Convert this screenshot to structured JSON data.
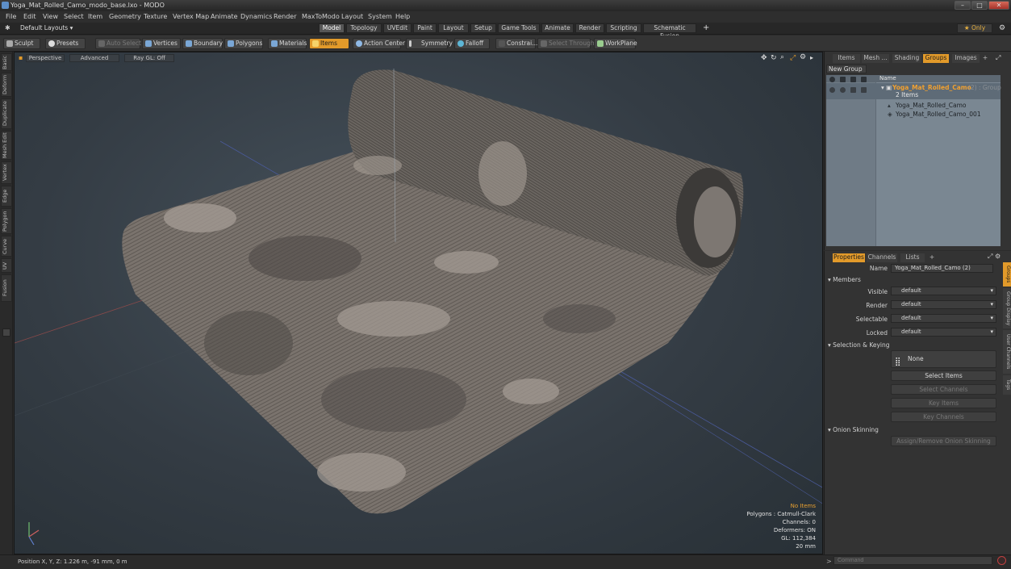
{
  "window": {
    "title": "Yoga_Mat_Rolled_Camo_modo_base.lxo - MODO",
    "buttons": [
      "–",
      "□",
      "✕"
    ]
  },
  "menu": [
    "File",
    "Edit",
    "View",
    "Select",
    "Item",
    "Geometry",
    "Texture",
    "Vertex Map",
    "Animate",
    "Dynamics",
    "Render",
    "MaxToModo",
    "Layout",
    "System",
    "Help"
  ],
  "layout_bar": {
    "layouts_label": "Default Layouts ▾",
    "tabs": [
      "Model",
      "Topology",
      "UVEdit",
      "Paint",
      "Layout",
      "Setup",
      "Game Tools",
      "Animate",
      "Render",
      "Scripting",
      "Schematic Fusion"
    ],
    "active_tab": "Model",
    "add": "+",
    "only_label": "★  Only",
    "gear": "⚙"
  },
  "toolbar": {
    "sculpt": "Sculpt",
    "presets": "Presets",
    "auto_select": "Auto Select",
    "vertices": "Vertices",
    "boundary": "Boundary",
    "polygons": "Polygons",
    "materials": "Materials",
    "items": "Items",
    "action_center": "Action Center",
    "symmetry": "Symmetry",
    "falloff": "Falloff",
    "constrain": "Constrai...",
    "select_through": "Select Through",
    "workplane": "WorkPlane"
  },
  "left_tabs": [
    "Basic",
    "Deform",
    "Duplicate",
    "Mesh Edit",
    "Vertex",
    "Edge",
    "Polygon",
    "Curve",
    "UV",
    "Fusion"
  ],
  "viewport": {
    "view": "Perspective",
    "shading": "Advanced",
    "raygl": "Ray GL: Off",
    "info": {
      "no_items": "No Items",
      "polygons": "Polygons : Catmull-Clark",
      "channels": "Channels: 0",
      "deformers": "Deformers: ON",
      "gl": "GL: 112,384",
      "size": "20 mm"
    }
  },
  "status": {
    "position": "Position X, Y, Z:   1.226 m, -91 mm, 0 m"
  },
  "groups_panel": {
    "tabs": [
      "Items",
      "Mesh ...",
      "Shading",
      "Groups",
      "Images",
      "+"
    ],
    "active_tab": "Groups",
    "new_group": "New Group",
    "column_name": "Name",
    "rows": [
      {
        "name": "Yoga_Mat_Rolled_Camo",
        "suffix": "(2) : Group",
        "count": "2 Items"
      },
      {
        "name": "Yoga_Mat_Rolled_Camo"
      },
      {
        "name": "Yoga_Mat_Rolled_Camo_001"
      }
    ]
  },
  "properties_panel": {
    "tabs": [
      "Properties",
      "Channels",
      "Lists",
      "+"
    ],
    "active_tab": "Properties",
    "name_label": "Name",
    "name_value": "Yoga_Mat_Rolled_Camo (2)",
    "members_section": "Members",
    "fields": [
      {
        "label": "Visible",
        "value": "default"
      },
      {
        "label": "Render",
        "value": "default"
      },
      {
        "label": "Selectable",
        "value": "default"
      },
      {
        "label": "Locked",
        "value": "default"
      }
    ],
    "selection_section": "Selection & Keying",
    "none_label": "None",
    "select_items": "Select Items",
    "select_channels": "Select Channels",
    "key_items": "Key Items",
    "key_channels": "Key Channels",
    "onion_section": "Onion Skinning",
    "assign_onion": "Assign/Remove Onion Skinning",
    "side_tabs": [
      "Groups",
      "Group Display",
      "User Channels",
      "Tags"
    ]
  },
  "command": {
    "placeholder": "Command"
  }
}
